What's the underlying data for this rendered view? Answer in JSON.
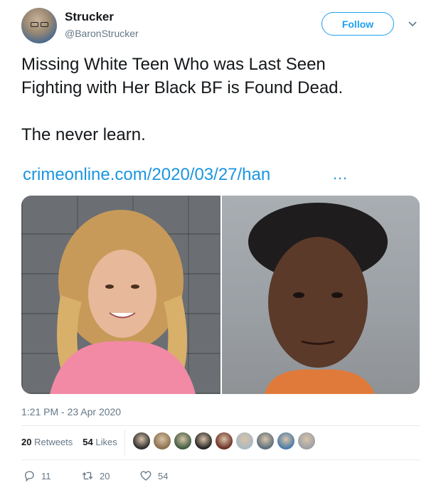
{
  "user": {
    "name": "Strucker",
    "handle": "@BaronStrucker",
    "follow_label": "Follow"
  },
  "tweet": {
    "text": "Missing White Teen Who was Last Seen\nFighting with Her Black BF is Found Dead.\n\nThe never learn.",
    "link_text": "crimeonline.com/2020/03/27/han",
    "link_ellipsis": "…",
    "timestamp": "1:21 PM - 23 Apr 2020"
  },
  "stats": {
    "retweets_count": "20",
    "retweets_label": "Retweets",
    "likes_count": "54",
    "likes_label": "Likes"
  },
  "likers": [
    "#2b2b2b",
    "#8a6e4b",
    "#3d5a3e",
    "#222222",
    "#6b2e22",
    "#aab8c2",
    "#5a6e7a",
    "#4a7aa8",
    "#9aa0a6"
  ],
  "actions": {
    "reply_count": "11",
    "retweet_count": "20",
    "like_count": "54"
  },
  "colors": {
    "accent": "#1da1f2",
    "link": "#1b95e0",
    "muted": "#657786"
  },
  "icons": [
    "chevron-down-icon",
    "reply-icon",
    "retweet-icon",
    "heart-icon"
  ]
}
